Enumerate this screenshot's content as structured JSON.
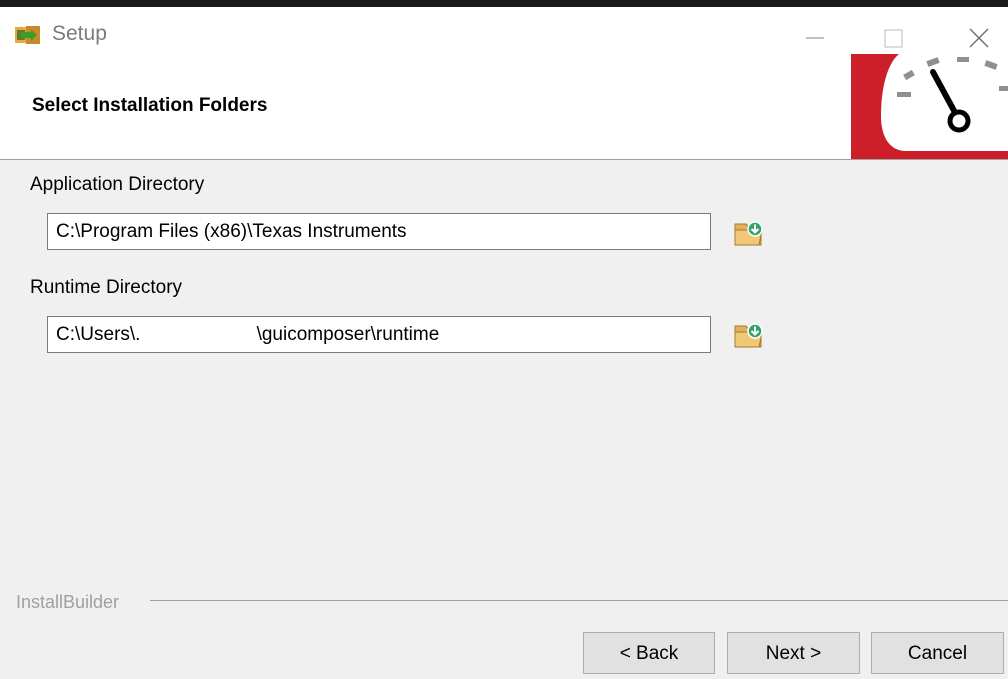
{
  "window": {
    "title": "Setup",
    "app_icon": "setup-icon",
    "controls": [
      "minimize-icon",
      "maximize-icon",
      "close-icon"
    ]
  },
  "header": {
    "title": "Select Installation Folders",
    "logo": "speedometer-logo",
    "logo_colors": {
      "red": "#cc1f2a",
      "gray": "#8f8f8f",
      "needle": "#000000"
    }
  },
  "form": {
    "application_directory": {
      "label": "Application Directory",
      "value": "C:\\Program Files (x86)\\Texas Instruments",
      "browse_icon": "folder-browse-icon"
    },
    "runtime_directory": {
      "label": "Runtime Directory",
      "value": "C:\\Users\\.                      \\guicomposer\\runtime",
      "browse_icon": "folder-browse-icon"
    }
  },
  "footer": {
    "brand": "InstallBuilder",
    "buttons": {
      "back": "< Back",
      "next": "Next >",
      "cancel": "Cancel"
    }
  }
}
